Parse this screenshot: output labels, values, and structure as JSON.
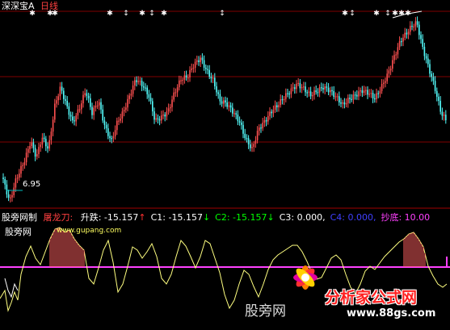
{
  "main_panel": {
    "title": "深深宝A",
    "period": "日线",
    "low_label": "6.95"
  },
  "indicator_panel": {
    "name": "股旁网制",
    "formula": "屠龙刀:",
    "params": [
      {
        "label": "升跌:",
        "value": "-15.157",
        "arrow": "↑",
        "color": "#ffffff",
        "arrow_color": "#ff3030"
      },
      {
        "label": "C1:",
        "value": "-15.157",
        "arrow": "↓",
        "color": "#ffffff",
        "arrow_color": "#00ff00"
      },
      {
        "label": "C2:",
        "value": "-15.157",
        "arrow": "↓",
        "color": "#00ff00",
        "arrow_color": "#00ff00"
      },
      {
        "label": "C3:",
        "value": "0.000,",
        "arrow": "",
        "color": "#ffffff",
        "arrow_color": ""
      },
      {
        "label": "C4:",
        "value": "0.000,",
        "arrow": "",
        "color": "#4040ff",
        "arrow_color": ""
      },
      {
        "label": "抄底:",
        "value": "10.00",
        "arrow": "",
        "color": "#ff40ff",
        "arrow_color": ""
      }
    ],
    "source_site": "股旁网",
    "source_url": "www.gupang.com"
  },
  "watermarks": {
    "center_text": "股旁网",
    "brand_name": "分析家公式网",
    "brand_url": "www.88gs.com"
  },
  "colors": {
    "up": "#ff5050",
    "down": "#54fcfc",
    "grid": "#800000",
    "divider": "#a00000",
    "oscillator": "#ffff80",
    "threshold": "#ff40ff",
    "bar": "#ff6060",
    "low_line": "#00c0c0"
  }
}
